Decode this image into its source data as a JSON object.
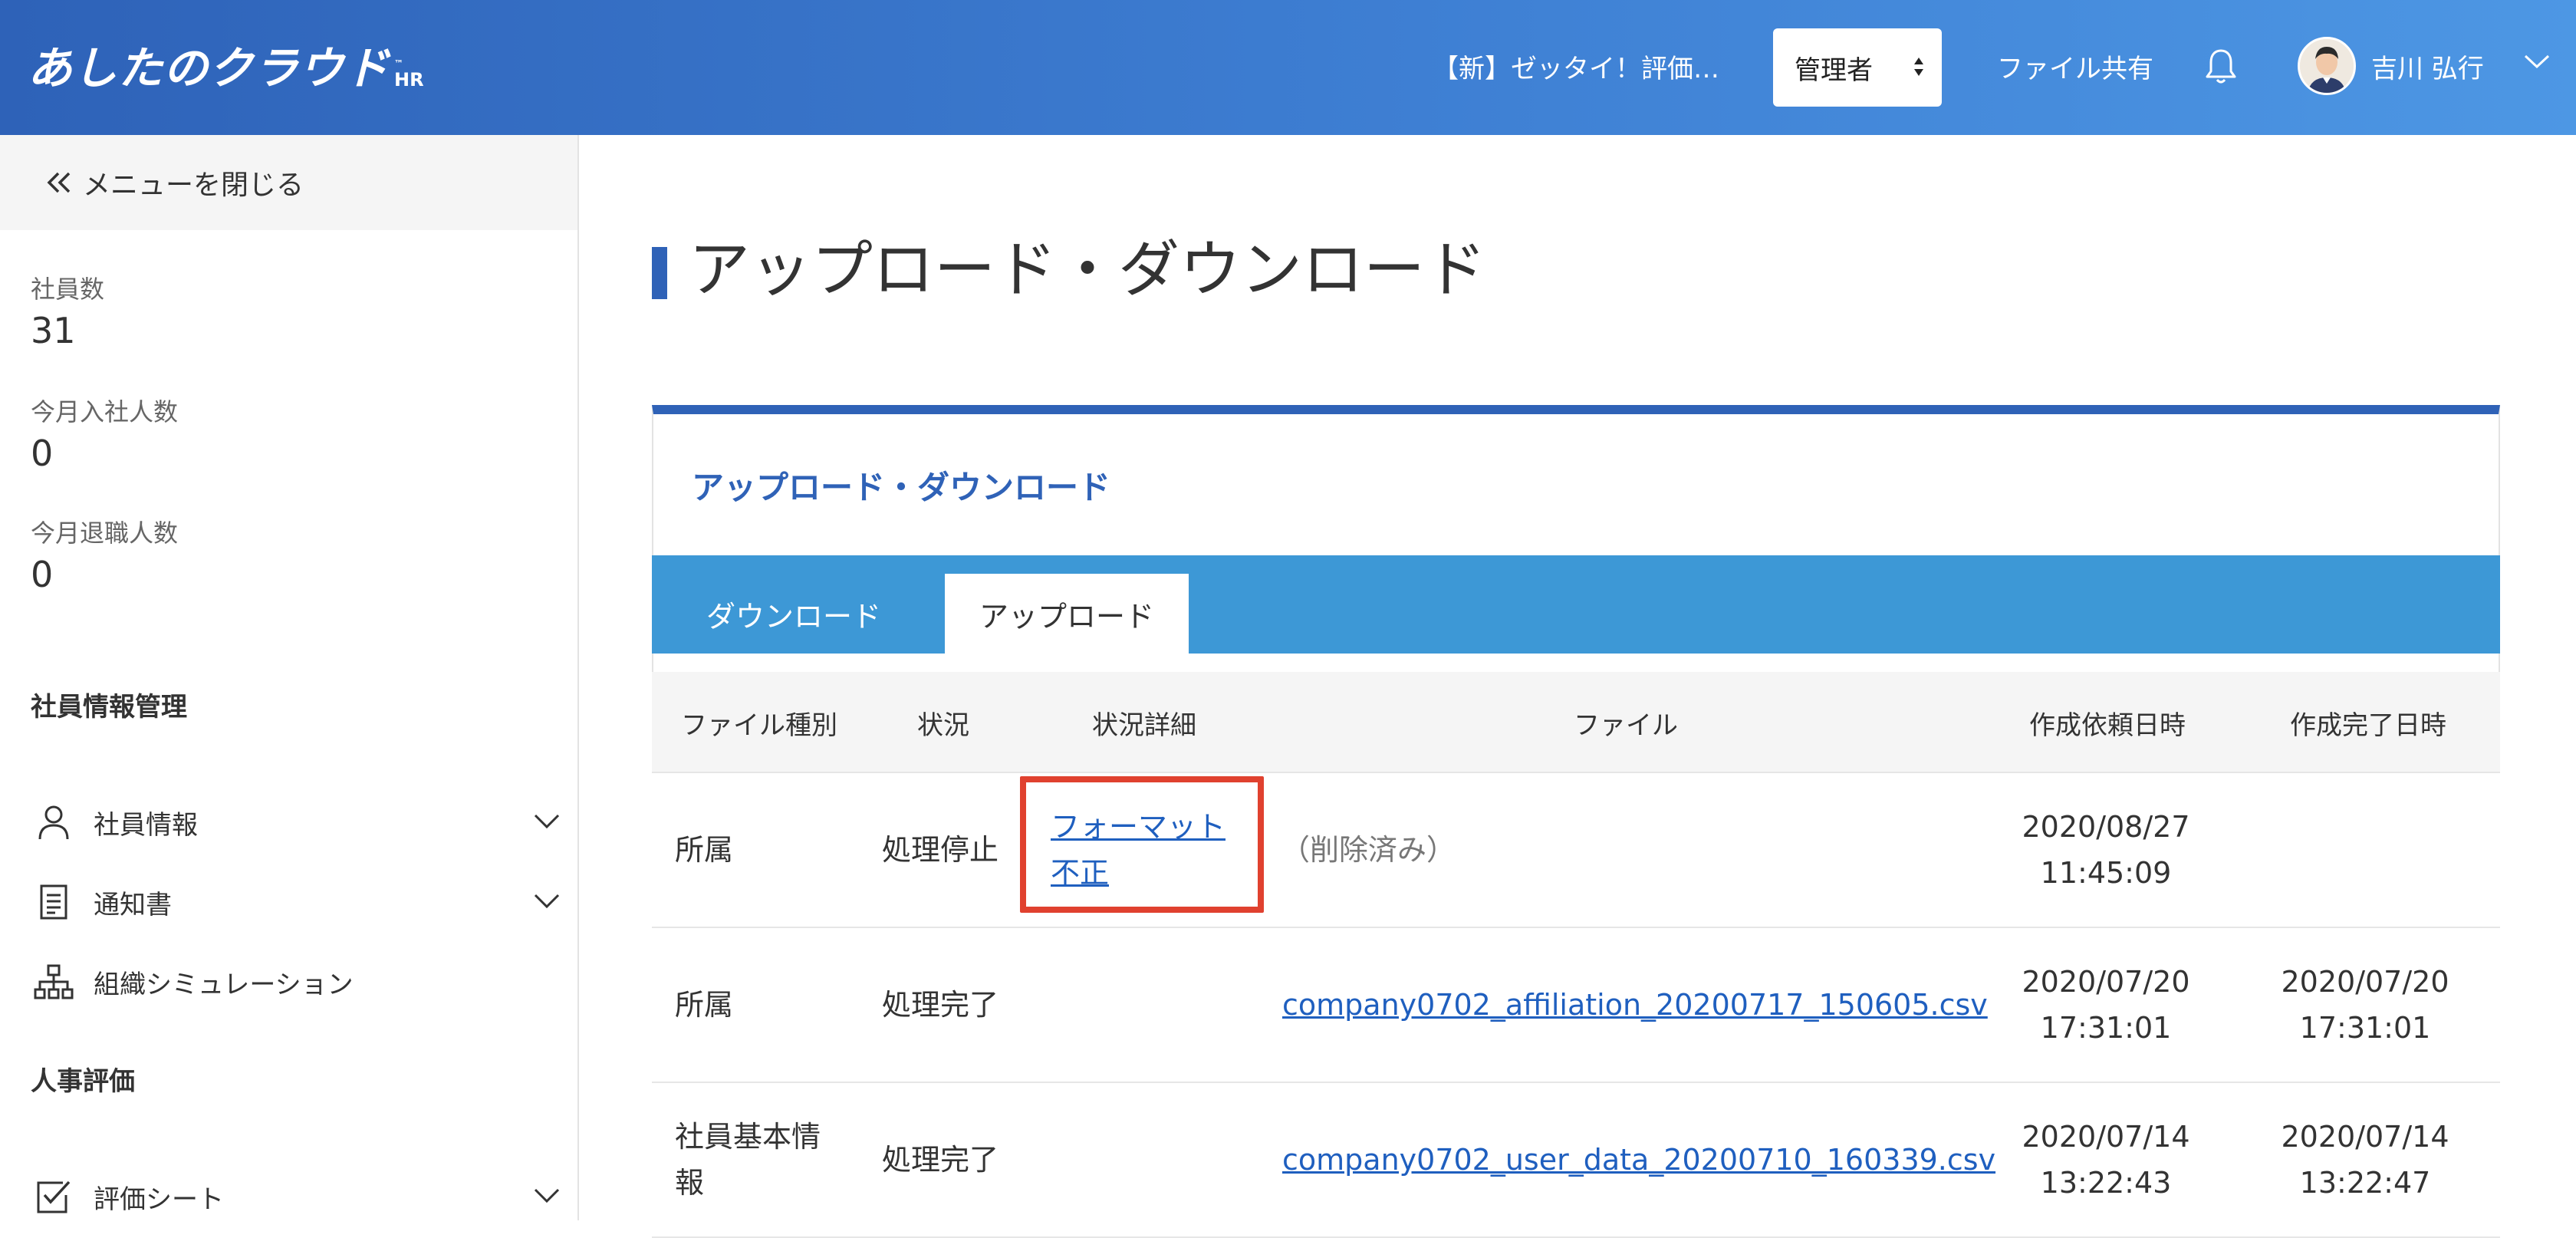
{
  "header": {
    "logo": "あしたのクラウド",
    "logo_sub": "HR",
    "logo_tm": "™",
    "notice": "【新】ゼッタイ！評価…",
    "role_select": "管理者",
    "file_share": "ファイル共有",
    "user_name": "吉川 弘行"
  },
  "sidebar": {
    "close_menu": "メニューを閉じる",
    "stats": [
      {
        "label": "社員数",
        "value": "31"
      },
      {
        "label": "今月入社人数",
        "value": "0"
      },
      {
        "label": "今月退職人数",
        "value": "0"
      }
    ],
    "sections": [
      {
        "title": "社員情報管理",
        "items": [
          {
            "label": "社員情報",
            "icon": "person-icon",
            "expandable": true
          },
          {
            "label": "通知書",
            "icon": "document-icon",
            "expandable": true
          },
          {
            "label": "組織シミュレーション",
            "icon": "org-chart-icon",
            "expandable": false
          }
        ]
      },
      {
        "title": "人事評価",
        "items": [
          {
            "label": "評価シート",
            "icon": "checkbox-sheet-icon",
            "expandable": true
          }
        ]
      }
    ]
  },
  "main": {
    "page_title": "アップロード・ダウンロード",
    "card_title": "アップロード・ダウンロード",
    "tabs": [
      {
        "label": "ダウンロード",
        "active": false
      },
      {
        "label": "アップロード",
        "active": true
      }
    ],
    "table": {
      "headers": [
        "ファイル種別",
        "状況",
        "状況詳細",
        "ファイル",
        "作成依頼日時",
        "作成完了日時"
      ],
      "rows": [
        {
          "type": "所属",
          "status": "処理停止",
          "detail": "フォーマット不正",
          "file": "（削除済み）",
          "file_deleted": true,
          "requested": "2020/08/27 11:45:09",
          "completed": ""
        },
        {
          "type": "所属",
          "status": "処理完了",
          "detail": "",
          "file": "company0702_affiliation_20200717_150605.csv",
          "file_deleted": false,
          "requested": "2020/07/20 17:31:01",
          "completed": "2020/07/20 17:31:01"
        },
        {
          "type": "社員基本情報",
          "status": "処理完了",
          "detail": "",
          "file": "company0702_user_data_20200710_160339.csv",
          "file_deleted": false,
          "requested": "2020/07/14 13:22:43",
          "completed": "2020/07/14 13:22:47"
        }
      ]
    }
  },
  "colors": {
    "header_start": "#2e62b8",
    "header_end": "#4d97e4",
    "accent": "#2f62b7",
    "tabbar": "#3d98d6",
    "link": "#1f5fbf",
    "highlight": "#e0412f"
  }
}
